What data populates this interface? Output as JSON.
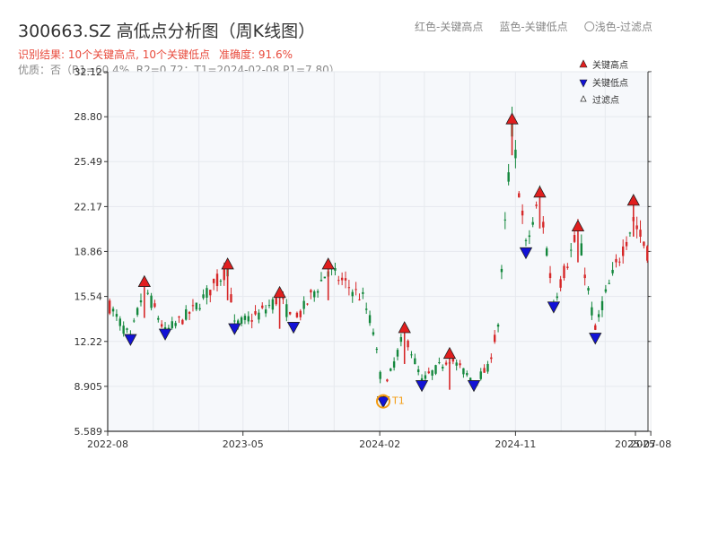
{
  "title": "300663.SZ 高低点分析图（周K线图）",
  "result": {
    "summary": "识别结果: 10个关键高点, 10个关键低点",
    "accuracy": "准确度: 91.6%"
  },
  "note": "优质：否（R1=60.4%, R2=0.72；T1=2024-02-08 P1=7.80）",
  "top_legend": {
    "red": "红色-关键高点",
    "blue": "蓝色-关键低点",
    "light": "〇浅色-过滤点"
  },
  "colors": {
    "up": "#d62728",
    "down": "#13873c",
    "high_marker": "#e11e1e",
    "low_marker": "#1212d6",
    "t1_marker": "#f39c12",
    "grid": "#e6e9ee",
    "plot_bg": "#f6f8fb"
  },
  "chart_data": {
    "type": "candlestick",
    "title": "300663.SZ 高低点分析图（周K线图）",
    "ylim": [
      5.589,
      32.12
    ],
    "y_ticks": [
      "5.589",
      "8.905",
      "12.22",
      "15.54",
      "18.86",
      "22.17",
      "25.49",
      "28.80",
      "32.12"
    ],
    "x_ticks": [
      "2022-08",
      "2023-05",
      "2024-02",
      "2024-11",
      "2025-07",
      "2025-08"
    ],
    "legend": [
      {
        "label": "关键高点",
        "marker": "triangle-up",
        "color": "#e11e1e"
      },
      {
        "label": "关键低点",
        "marker": "triangle-down",
        "color": "#1212d6"
      },
      {
        "label": "过滤点",
        "marker": "triangle-up-outline",
        "color": "#ffffff"
      }
    ],
    "t1": {
      "label": "T1",
      "date": "2024-02-08",
      "price": 7.8
    },
    "key_highs": [
      {
        "date": "2022-10-14",
        "price": 16.6
      },
      {
        "date": "2023-03-31",
        "price": 17.9
      },
      {
        "date": "2023-07-14",
        "price": 15.8
      },
      {
        "date": "2023-10-20",
        "price": 17.9
      },
      {
        "date": "2024-03-22",
        "price": 13.2
      },
      {
        "date": "2024-06-21",
        "price": 11.3
      },
      {
        "date": "2024-10-25",
        "price": 28.6
      },
      {
        "date": "2024-12-20",
        "price": 23.2
      },
      {
        "date": "2025-03-07",
        "price": 20.7
      },
      {
        "date": "2025-06-27",
        "price": 22.6
      }
    ],
    "key_lows": [
      {
        "date": "2022-09-16",
        "price": 12.4
      },
      {
        "date": "2022-11-25",
        "price": 12.8
      },
      {
        "date": "2023-04-14",
        "price": 13.2
      },
      {
        "date": "2023-08-11",
        "price": 13.3
      },
      {
        "date": "2024-02-08",
        "price": 7.8
      },
      {
        "date": "2024-04-26",
        "price": 9.0
      },
      {
        "date": "2024-08-09",
        "price": 9.0
      },
      {
        "date": "2024-11-22",
        "price": 18.8
      },
      {
        "date": "2025-01-17",
        "price": 14.8
      },
      {
        "date": "2025-04-11",
        "price": 12.5
      }
    ]
  }
}
